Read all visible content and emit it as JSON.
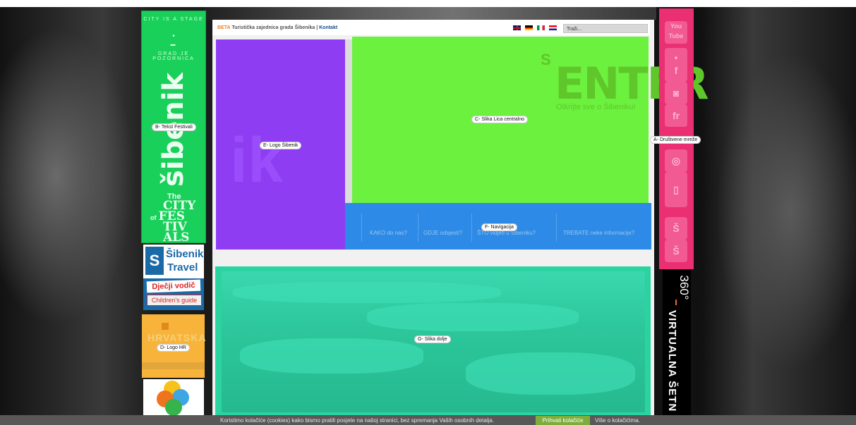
{
  "left": {
    "tagline_top": "CITY IS A STAGE",
    "tagline_bottom": "GRAD JE POZORNICA",
    "brand": "šibenik",
    "city_the": "The",
    "city_word": "CITY",
    "city_of": "of",
    "festivals": [
      "FES",
      "TIV",
      "ALS"
    ],
    "travel_line1": "Šibenik",
    "travel_line2": "Travel",
    "kids_hr": "Dječji vodič",
    "kids_en": "Children's guide",
    "hrvatska": "HRVATSKA"
  },
  "header": {
    "beta": "BETA",
    "title": "Turistička zajednica grada Šibenika |",
    "contact": "Kontakt",
    "search_placeholder": "Traži..."
  },
  "hero": {
    "enter": "ENTER",
    "subtitle": "Otkrijte sve o Šibeniku!"
  },
  "nav": [
    {
      "label": "KAKO do nas?"
    },
    {
      "label": "GDJE odsjesti?"
    },
    {
      "label": "ŠTO vidjeti u Šibeniku?"
    },
    {
      "label": "TREBATE neke informacije?"
    }
  ],
  "virtual": {
    "num": "360°",
    "text": "VIRTUALNA ŠETN"
  },
  "annotations": {
    "a": "A- Društvene mreže",
    "b": "B- Tekst Festivali",
    "c": "C- Slika Lica centralno",
    "d": "D- Logo HR",
    "e": "E- Logo Šibenik",
    "f": "F- Navigacija",
    "g": "G- Slika dolje"
  },
  "cookie": {
    "text": "Koristimo kolačiće (cookies) kako bismo pratili posjete na našoj stranici, bez spremanja Vaših osobnih detalja.",
    "accept": "Prihvati kolačiće",
    "more": "Više o kolačićima."
  },
  "colors": {
    "green": "#19d05a",
    "purple": "#8e3df2",
    "lime": "#6cf13f",
    "blue": "#2d8ae6",
    "teal": "#2bd3a0",
    "pink": "#ea2f73",
    "orange": "#f8b33a"
  }
}
